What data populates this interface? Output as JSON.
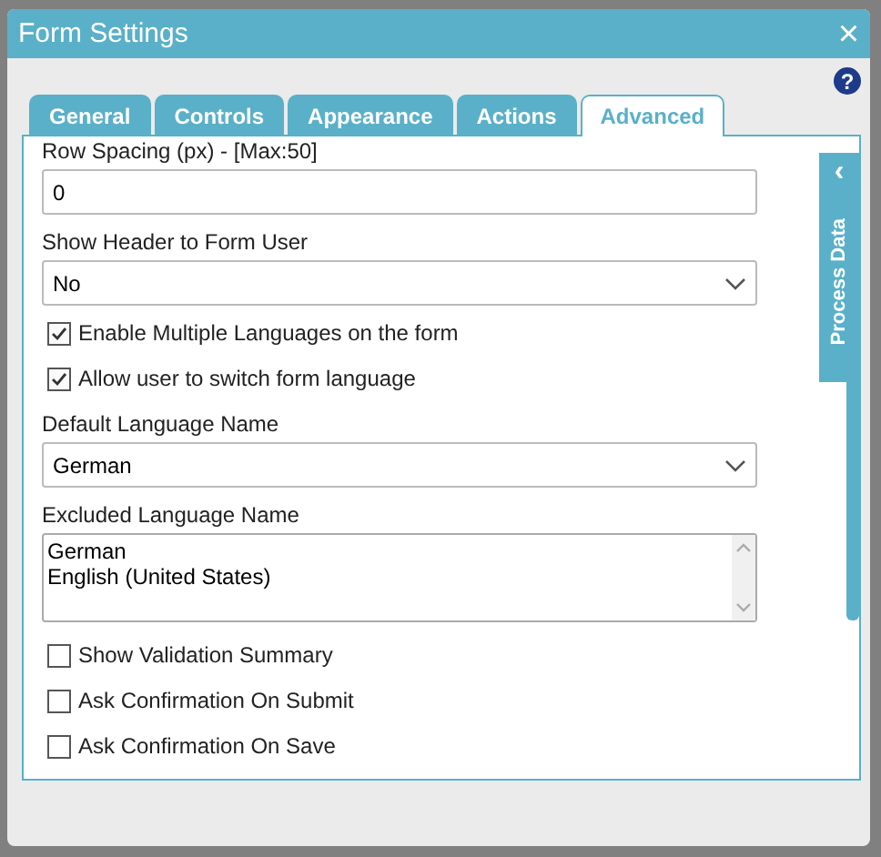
{
  "window": {
    "title": "Form Settings",
    "close": "×"
  },
  "help": "?",
  "tabs": [
    {
      "label": "General",
      "selected": false
    },
    {
      "label": "Controls",
      "selected": false
    },
    {
      "label": "Appearance",
      "selected": false
    },
    {
      "label": "Actions",
      "selected": false
    },
    {
      "label": "Advanced",
      "selected": true
    }
  ],
  "side_panel": {
    "label": "Process Data",
    "arrow": "‹"
  },
  "fields": [
    {
      "kind": "label",
      "text": "Row Spacing (px) - [Max:50]"
    },
    {
      "kind": "text",
      "value": "0"
    },
    {
      "kind": "label",
      "text": "Show Header to Form User"
    },
    {
      "kind": "select",
      "value": "No"
    },
    {
      "kind": "checkbox",
      "text": "Enable Multiple Languages on the form",
      "checked": true
    },
    {
      "kind": "checkbox",
      "text": "Allow user to switch form language",
      "checked": true
    },
    {
      "kind": "label",
      "text": "Default Language Name"
    },
    {
      "kind": "select",
      "value": "German"
    },
    {
      "kind": "label",
      "text": "Excluded Language Name"
    },
    {
      "kind": "listbox",
      "options": [
        "German",
        "English (United States)"
      ]
    },
    {
      "kind": "checkbox",
      "text": "Show Validation Summary",
      "checked": false
    },
    {
      "kind": "checkbox",
      "text": "Ask Confirmation On Submit",
      "checked": false
    },
    {
      "kind": "checkbox",
      "text": "Ask Confirmation On Save",
      "checked": false
    }
  ]
}
